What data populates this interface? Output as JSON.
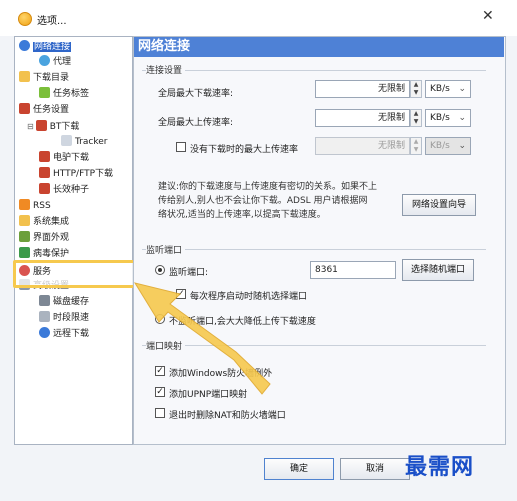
{
  "window": {
    "title": "选项..."
  },
  "sidebar": {
    "items": [
      {
        "label": "网络连接",
        "icon": "network-icon"
      },
      {
        "label": "代理",
        "icon": "proxy-globe-icon"
      },
      {
        "label": "下载目录",
        "icon": "folder-icon"
      },
      {
        "label": "任务标签",
        "icon": "tag-icon"
      },
      {
        "label": "任务设置",
        "icon": "task-settings-icon"
      },
      {
        "label": "BT下载",
        "icon": "bt-icon"
      },
      {
        "label": "Tracker",
        "icon": "tracker-icon"
      },
      {
        "label": "电驴下载",
        "icon": "ed2k-icon"
      },
      {
        "label": "HTTP/FTP下载",
        "icon": "http-ftp-icon"
      },
      {
        "label": "长效种子",
        "icon": "seed-icon"
      },
      {
        "label": "RSS",
        "icon": "rss-icon"
      },
      {
        "label": "系统集成",
        "icon": "system-integration-icon"
      },
      {
        "label": "界面外观",
        "icon": "appearance-icon"
      },
      {
        "label": "病毒保护",
        "icon": "virus-protection-icon"
      },
      {
        "label": "服务",
        "icon": "service-icon"
      },
      {
        "label": "高级设置",
        "icon": "advanced-settings-icon"
      },
      {
        "label": "磁盘缓存",
        "icon": "disk-cache-icon"
      },
      {
        "label": "时段限速",
        "icon": "time-limit-icon"
      },
      {
        "label": "远程下载",
        "icon": "remote-download-icon"
      }
    ]
  },
  "panel": {
    "title": "网络连接",
    "connection": {
      "group_title": "连接设置",
      "max_download_label": "全局最大下载速率:",
      "max_download_value": "无限制",
      "max_upload_label": "全局最大上传速率:",
      "max_upload_value": "无限制",
      "idle_upload_label": "没有下载时的最大上传速率",
      "idle_upload_value": "无限制",
      "unit": "KB/s",
      "info_line1": "建议:你的下载速度与上传速度有密切的关系。如果不上",
      "info_line2": "传给别人,别人也不会让你下载。ADSL 用户请根据网",
      "info_line3": "络状况,适当的上传速率,以提高下载速度。",
      "wizard_button": "网络设置向导"
    },
    "listen": {
      "group_title": "监听端口",
      "port_label": "监听端口:",
      "port_value": "8361",
      "random_port_button": "选择随机端口",
      "random_on_start_label": "每次程序启动时随机选择端口",
      "no_listen_label": "不监听端口,会大大降低上传下载速度"
    },
    "mapping": {
      "group_title": "端口映射",
      "add_windows_firewall": "添加Windows防火墙例外",
      "add_upnp": "添加UPNP端口映射",
      "remove_on_exit": "退出时删除NAT和防火墙端口"
    }
  },
  "footer": {
    "ok_button": "确定",
    "cancel_button": "取消"
  },
  "watermark": "最需网",
  "colors": {
    "accent": "#4e81d6",
    "highlight": "#f6c94e",
    "selected": "#2f66c9"
  }
}
